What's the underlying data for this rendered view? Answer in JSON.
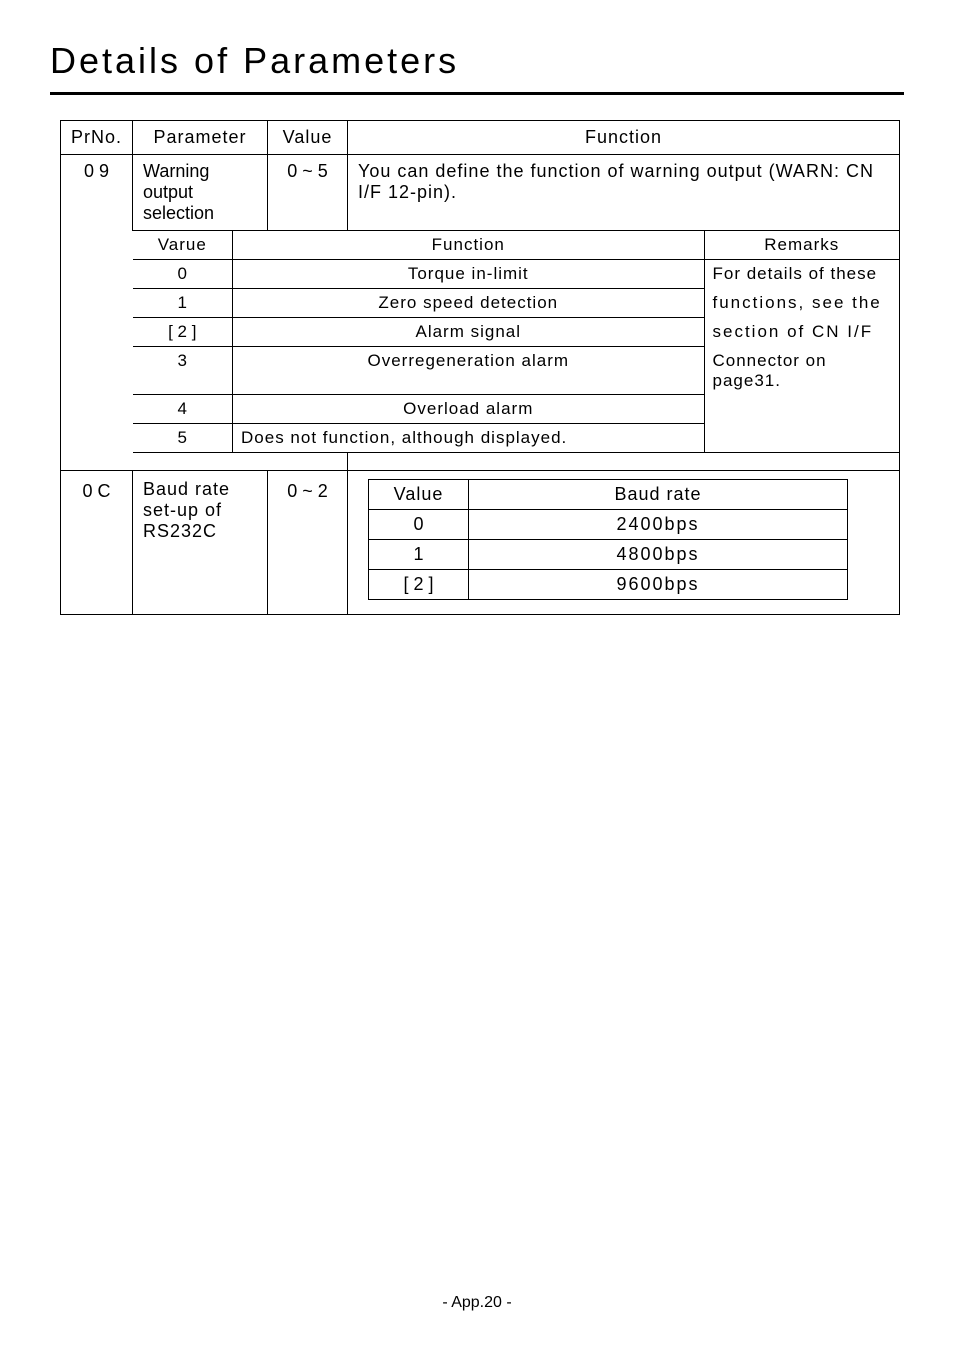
{
  "title": "Details of Parameters",
  "headers": {
    "prno": "PrNo.",
    "parameter": "Parameter",
    "value": "Value",
    "function": "Function"
  },
  "row09": {
    "prno": "0 9",
    "parameter": "Warning output selection",
    "value": "0 ~ 5",
    "function": "You can define the function of warning output (WARN: CN I/F 12-pin)."
  },
  "warning_table": {
    "headers": {
      "varue": "Varue",
      "function": "Function",
      "remarks": "Remarks"
    },
    "rows": [
      {
        "val": "0",
        "func": "Torque in-limit"
      },
      {
        "val": "1",
        "func": "Zero speed detection"
      },
      {
        "val": "[ 2 ]",
        "func": "Alarm signal"
      },
      {
        "val": "3",
        "func": "Overregeneration alarm"
      },
      {
        "val": "4",
        "func": "Overload alarm"
      },
      {
        "val": "5",
        "func": "Does not function, although displayed."
      }
    ],
    "remarks_lines": [
      "For details of these",
      "functions, see the",
      "section of CN I/F",
      "Connector on page31."
    ]
  },
  "row0C": {
    "prno": "0 C",
    "parameter_line1": "Baud rate",
    "parameter_line2": "set-up of",
    "parameter_line3": "RS232C",
    "value": "0 ~ 2"
  },
  "baud_table": {
    "headers": {
      "value": "Value",
      "baud_rate": "Baud rate"
    },
    "rows": [
      {
        "val": "0",
        "rate": "2400bps"
      },
      {
        "val": "1",
        "rate": "4800bps"
      },
      {
        "val": "[ 2 ]",
        "rate": "9600bps"
      }
    ]
  },
  "footer": "- App.20 -",
  "chart_data": {
    "type": "table",
    "tables": [
      {
        "title": "Warning output selection (PrNo. 09, Value 0~5)",
        "columns": [
          "Varue",
          "Function"
        ],
        "rows": [
          [
            "0",
            "Torque in-limit"
          ],
          [
            "1",
            "Zero speed detection"
          ],
          [
            "[2]",
            "Alarm signal"
          ],
          [
            "3",
            "Overregeneration alarm"
          ],
          [
            "4",
            "Overload alarm"
          ],
          [
            "5",
            "Does not function, although displayed."
          ]
        ],
        "remarks": "For details of these functions, see the section of CN I/F Connector on page31."
      },
      {
        "title": "Baud rate set-up of RS232C (PrNo. 0C, Value 0~2)",
        "columns": [
          "Value",
          "Baud rate"
        ],
        "rows": [
          [
            "0",
            "2400bps"
          ],
          [
            "1",
            "4800bps"
          ],
          [
            "[2]",
            "9600bps"
          ]
        ]
      }
    ]
  }
}
